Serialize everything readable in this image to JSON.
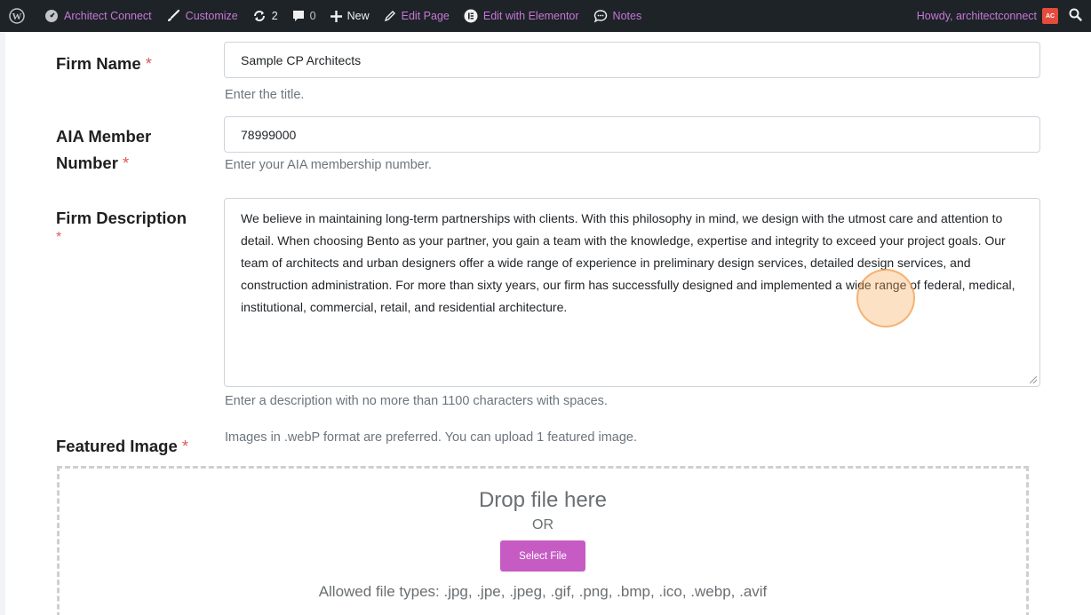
{
  "adminbar": {
    "site_name": "Architect Connect",
    "customize": "Customize",
    "updates_count": "2",
    "comments_count": "0",
    "new_label": "New",
    "edit_page": "Edit Page",
    "edit_elementor": "Edit with Elementor",
    "notes": "Notes",
    "howdy": "Howdy, architectconnect",
    "avatar_text": "AC"
  },
  "form": {
    "firm_name": {
      "label": "Firm Name",
      "required_mark": "*",
      "value": "Sample CP Architects",
      "help": "Enter the title."
    },
    "aia_member": {
      "label_line1": "AIA Member",
      "label_line2": "Number",
      "required_mark": "*",
      "value": "78999000",
      "help": "Enter your AIA membership number."
    },
    "firm_description": {
      "label": "Firm Description",
      "required_mark": "*",
      "value": "We believe in maintaining long-term partnerships with clients. With this philosophy in mind, we design with the utmost care and attention to detail. When choosing Bento as your partner, you gain a team with the knowledge, expertise and integrity to exceed your project goals. Our team of architects and urban designers offer a wide range of experience in preliminary design services, detailed design services, and construction administration. For more than sixty years, our firm has successfully designed and implemented a wide range of federal, medical, institutional, commercial, retail, and residential architecture.",
      "help": "Enter a description with no more than 1100 characters with spaces."
    },
    "featured_image": {
      "label": "Featured Image",
      "required_mark": "*",
      "help": "Images in .webP format are preferred. You can upload 1 featured image.",
      "drop_title": "Drop file here",
      "drop_or": "OR",
      "select_button": "Select File",
      "allowed_types": "Allowed file types: .jpg, .jpe, .jpeg, .gif, .png, .bmp, .ico, .webp, .avif"
    }
  },
  "colors": {
    "adminbar_bg": "#1d2327",
    "accent_pink": "#c65bc4",
    "required_red": "#e05a5a"
  }
}
